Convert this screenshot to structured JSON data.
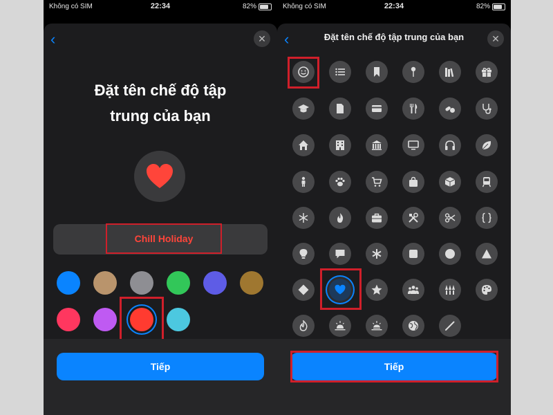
{
  "status": {
    "carrier": "Không có SIM",
    "time": "22:34",
    "battery": "82%"
  },
  "left": {
    "title_line1": "Đặt tên chế độ tập",
    "title_line2": "trung của bạn",
    "focus_name": "Chill Holiday",
    "selected_color": "#ff3b30",
    "colors": [
      "#0a84ff",
      "#b9946c",
      "#8e8e93",
      "#32c759",
      "#5e5ce6",
      "#9f7730",
      "#ff375f",
      "#bf5af2",
      "#ff3b30",
      "#4cc8e0"
    ],
    "next_label": "Tiếp"
  },
  "right": {
    "header_title": "Đặt tên chế độ tập trung của bạn",
    "next_label": "Tiếp",
    "selected_icon": "heart-icon",
    "icons": [
      "smiley-icon",
      "list-icon",
      "bookmark-icon",
      "pin-icon",
      "books-icon",
      "gift-icon",
      "graduation-cap-icon",
      "document-icon",
      "credit-card-icon",
      "fork-knife-icon",
      "pills-icon",
      "stethoscope-icon",
      "house-icon",
      "building-icon",
      "bank-icon",
      "monitor-icon",
      "headphones-icon",
      "leaf-icon",
      "person-icon",
      "paw-icon",
      "cart-icon",
      "bag-icon",
      "box-icon",
      "train-icon",
      "snowflake-icon",
      "flame-icon",
      "briefcase-icon",
      "tools-icon",
      "scissors-icon",
      "braces-icon",
      "lightbulb-icon",
      "speech-bubble-icon",
      "asterisk-icon",
      "square-icon",
      "circle-icon",
      "triangle-icon",
      "diamond-icon",
      "heart-icon",
      "star-icon",
      "people-icon",
      "choir-icon",
      "palette-icon",
      "fire-icon",
      "sunrise-icon",
      "sunset-icon",
      "globe-icon",
      "wand-icon"
    ]
  }
}
